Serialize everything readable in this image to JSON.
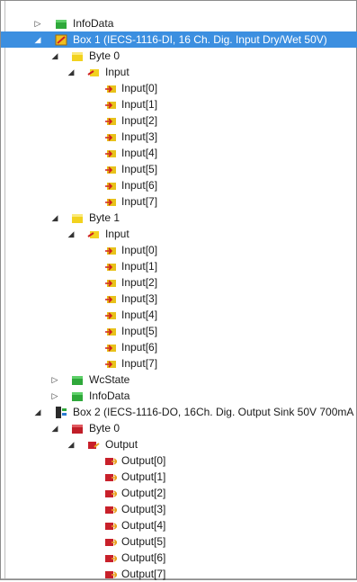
{
  "tree": {
    "top_infodata": {
      "label": "InfoData",
      "expander": "collapsed",
      "icon": "green-box-icon"
    },
    "box1": {
      "label": "Box 1 (IECS-1116-DI, 16 Ch. Dig. Input Dry/Wet 50V)",
      "expander": "expanded",
      "icon": "terminal-box-icon",
      "selected": true,
      "bytes": [
        {
          "label": "Byte 0",
          "icon": "yellow-box-icon",
          "group": {
            "label": "Input",
            "icon": "input-group-icon",
            "items": [
              "Input[0]",
              "Input[1]",
              "Input[2]",
              "Input[3]",
              "Input[4]",
              "Input[5]",
              "Input[6]",
              "Input[7]"
            ]
          }
        },
        {
          "label": "Byte 1",
          "icon": "yellow-box-icon",
          "group": {
            "label": "Input",
            "icon": "input-group-icon",
            "items": [
              "Input[0]",
              "Input[1]",
              "Input[2]",
              "Input[3]",
              "Input[4]",
              "Input[5]",
              "Input[6]",
              "Input[7]"
            ]
          }
        }
      ],
      "wcstate": "WcState",
      "infodata": "InfoData"
    },
    "box2": {
      "label": "Box 2 (IECS-1116-DO, 16Ch. Dig. Output Sink 50V 700mA",
      "expander": "expanded",
      "icon": "device-box-icon",
      "byte": {
        "label": "Byte 0",
        "icon": "red-box-icon",
        "group": {
          "label": "Output",
          "icon": "output-group-icon",
          "items": [
            "Output[0]",
            "Output[1]",
            "Output[2]",
            "Output[3]",
            "Output[4]",
            "Output[5]",
            "Output[6]",
            "Output[7]"
          ]
        }
      }
    }
  },
  "colors": {
    "selection": "#3c8fe0",
    "input_icon": "#e8c21a",
    "output_icon": "#c8202a",
    "green_box": "#2fa83a",
    "yellow_box": "#f2d21e",
    "red_box": "#c01e28"
  },
  "icons": {
    "collapsed": "▷",
    "expanded": "◢"
  }
}
